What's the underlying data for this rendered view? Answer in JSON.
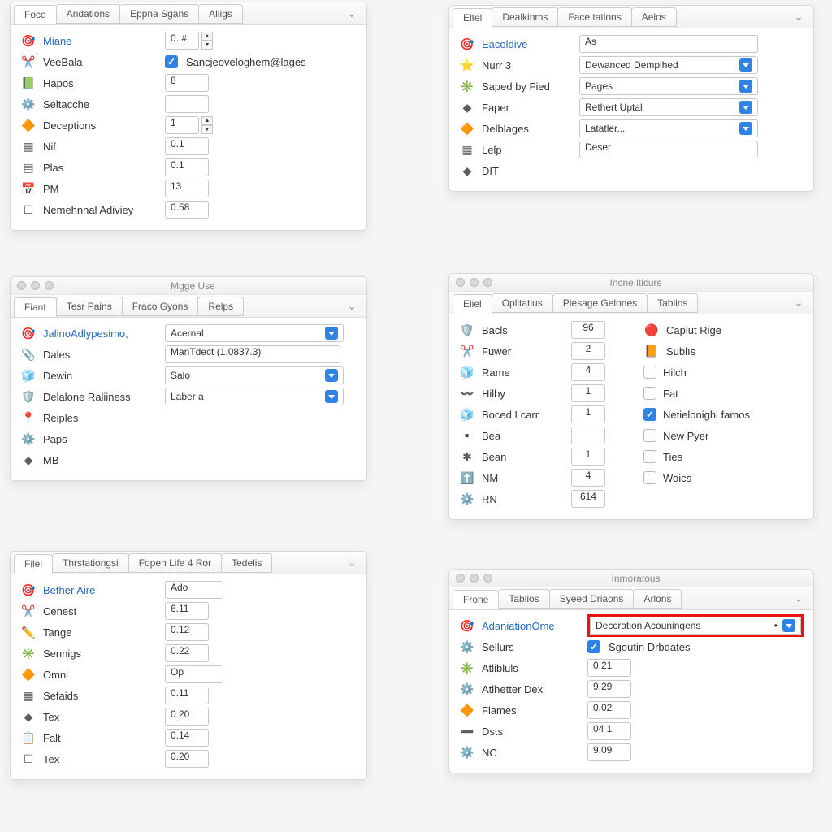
{
  "panel1": {
    "tabs": [
      "Foce",
      "Andations",
      "Eppna Sgans",
      "Alligs"
    ],
    "rows": [
      {
        "icon": "miane",
        "label": "Miane",
        "link": true,
        "valType": "num-step",
        "val": "0. #"
      },
      {
        "icon": "veebala",
        "label": "VeeBala",
        "valType": "chk-label",
        "checked": true,
        "val": "Sancjeoveloghem@lages"
      },
      {
        "icon": "hapos",
        "label": "Hapos",
        "valType": "num",
        "val": "8"
      },
      {
        "icon": "seltacche",
        "label": "Seltacche",
        "valType": "num",
        "val": ""
      },
      {
        "icon": "deceptions",
        "label": "Deceptions",
        "valType": "num-step",
        "val": "1"
      },
      {
        "icon": "nif",
        "label": "Nif",
        "valType": "num",
        "val": "0.1"
      },
      {
        "icon": "plas",
        "label": "Plas",
        "valType": "num",
        "val": "0.1"
      },
      {
        "icon": "pm",
        "label": "PM",
        "valType": "num",
        "val": "13"
      },
      {
        "icon": "nemehnnal",
        "label": "Nemehnnal Adiviey",
        "valType": "num",
        "val": "0.58"
      }
    ]
  },
  "panel2": {
    "tabs": [
      "Eltel",
      "Dealkinms",
      "Face tations",
      "Aelos"
    ],
    "rows": [
      {
        "icon": "eaco",
        "label": "Eacoldive",
        "link": true,
        "valType": "text",
        "val": "As"
      },
      {
        "icon": "nurr",
        "label": "Nurr 3",
        "valType": "select",
        "val": "Dewanced Demplhed"
      },
      {
        "icon": "saped",
        "label": "Saped by Fied",
        "valType": "select",
        "val": "Pages"
      },
      {
        "icon": "faper",
        "label": "Faper",
        "valType": "select",
        "val": "Rethert Uptal"
      },
      {
        "icon": "delblages",
        "label": "Delblages",
        "valType": "select",
        "val": "Latatler..."
      },
      {
        "icon": "lelp",
        "label": "Lelp",
        "valType": "text",
        "val": "Deser"
      },
      {
        "icon": "dit",
        "label": "DIT",
        "valType": "none"
      }
    ]
  },
  "panel3": {
    "title": "Mgge Use",
    "tabs": [
      "Fiant",
      "Tesr Pains",
      "Fraco Gyons",
      "Relps"
    ],
    "rows": [
      {
        "icon": "jalino",
        "label": "JalinoAdlypesimo,",
        "link": true,
        "valType": "select",
        "val": "Acernal"
      },
      {
        "icon": "dales",
        "label": "Dales",
        "valType": "text-wide",
        "val": "ManTdect (1.0837.3)"
      },
      {
        "icon": "dewin",
        "label": "Dewin",
        "valType": "select",
        "val": "Salo"
      },
      {
        "icon": "delalone",
        "label": "Delalone Raliiness",
        "valType": "select",
        "val": "Laber a"
      },
      {
        "icon": "reiples",
        "label": "Reiples",
        "valType": "none"
      },
      {
        "icon": "paps",
        "label": "Paps",
        "valType": "none"
      },
      {
        "icon": "mb",
        "label": "MB",
        "valType": "none"
      }
    ]
  },
  "panel4": {
    "title": "Incne lticurs",
    "tabs": [
      "Eliel",
      "Oplitatius",
      "Plesage Gelones",
      "Tablins"
    ],
    "left": [
      {
        "icon": "bacls",
        "label": "Bacls",
        "val": "96"
      },
      {
        "icon": "fuwer",
        "label": "Fuwer",
        "val": "2"
      },
      {
        "icon": "rame",
        "label": "Rame",
        "val": "4"
      },
      {
        "icon": "hilby",
        "label": "Hilby",
        "val": "1"
      },
      {
        "icon": "boced",
        "label": "Boced Lcarr",
        "val": "1"
      },
      {
        "icon": "bea",
        "label": "Bea",
        "val": ""
      },
      {
        "icon": "bean",
        "label": "Bean",
        "val": "1"
      },
      {
        "icon": "nm",
        "label": "NM",
        "val": "4"
      },
      {
        "icon": "rn",
        "label": "RN",
        "val": "614"
      }
    ],
    "right": [
      {
        "icon": "caplut",
        "label": "Caplut Rige",
        "chk": "orange"
      },
      {
        "icon": "sublis",
        "label": "Sublıs",
        "chk": "off"
      },
      {
        "icon": "hich",
        "label": "Hilch",
        "chk": "off"
      },
      {
        "icon": "fat",
        "label": "Fat",
        "chk": "off"
      },
      {
        "icon": "netie",
        "label": "Netielonighi famos",
        "chk": "on"
      },
      {
        "icon": "newpyer",
        "label": "New Pyer",
        "chk": "off"
      },
      {
        "icon": "ties",
        "label": "Ties",
        "chk": "off"
      },
      {
        "icon": "woics",
        "label": "Woics",
        "chk": "off"
      }
    ]
  },
  "panel5": {
    "tabs": [
      "Filel",
      "Thrstationgsi",
      "Fopen Life 4 Ror",
      "Tedelis"
    ],
    "rows": [
      {
        "icon": "bether",
        "label": "Bether Aire",
        "link": true,
        "valType": "text-s",
        "val": "Ado"
      },
      {
        "icon": "cenest",
        "label": "Cenest",
        "valType": "num",
        "val": "6.11"
      },
      {
        "icon": "tange",
        "label": "Tange",
        "valType": "num",
        "val": "0.12"
      },
      {
        "icon": "sennigs",
        "label": "Sennigs",
        "valType": "num",
        "val": "0.22"
      },
      {
        "icon": "omni",
        "label": "Omni",
        "valType": "text-s",
        "val": "Op"
      },
      {
        "icon": "sefaids",
        "label": "Sefaids",
        "valType": "num",
        "val": "0.11"
      },
      {
        "icon": "tex",
        "label": "Tex",
        "valType": "num",
        "val": "0.20"
      },
      {
        "icon": "falt",
        "label": "Falt",
        "valType": "num",
        "val": "0.14"
      },
      {
        "icon": "tex2",
        "label": "Tex",
        "valType": "num",
        "val": "0.20"
      }
    ]
  },
  "panel6": {
    "title": "Inmoratous",
    "tabs": [
      "Frone",
      "Tablios",
      "Syeed Driaons",
      "Arlons"
    ],
    "rows": [
      {
        "icon": "adani",
        "label": "AdaniationOme",
        "link": true,
        "valType": "select-hl",
        "val": "Deccration Acouningens"
      },
      {
        "icon": "sellurs",
        "label": "Sellurs",
        "valType": "chk-label",
        "checked": true,
        "val": "Sgoutin Drbdates"
      },
      {
        "icon": "atlibluls",
        "label": "Atlibluls",
        "valType": "num",
        "val": "0.21"
      },
      {
        "icon": "atlhetter",
        "label": "Atlhetter Dex",
        "valType": "num",
        "val": "9.29"
      },
      {
        "icon": "flames",
        "label": "Flames",
        "valType": "num",
        "val": "0.02"
      },
      {
        "icon": "dsts",
        "label": "Dsts",
        "valType": "num",
        "val": "04 1"
      },
      {
        "icon": "nc",
        "label": "NC",
        "valType": "num",
        "val": "9.09"
      }
    ]
  }
}
